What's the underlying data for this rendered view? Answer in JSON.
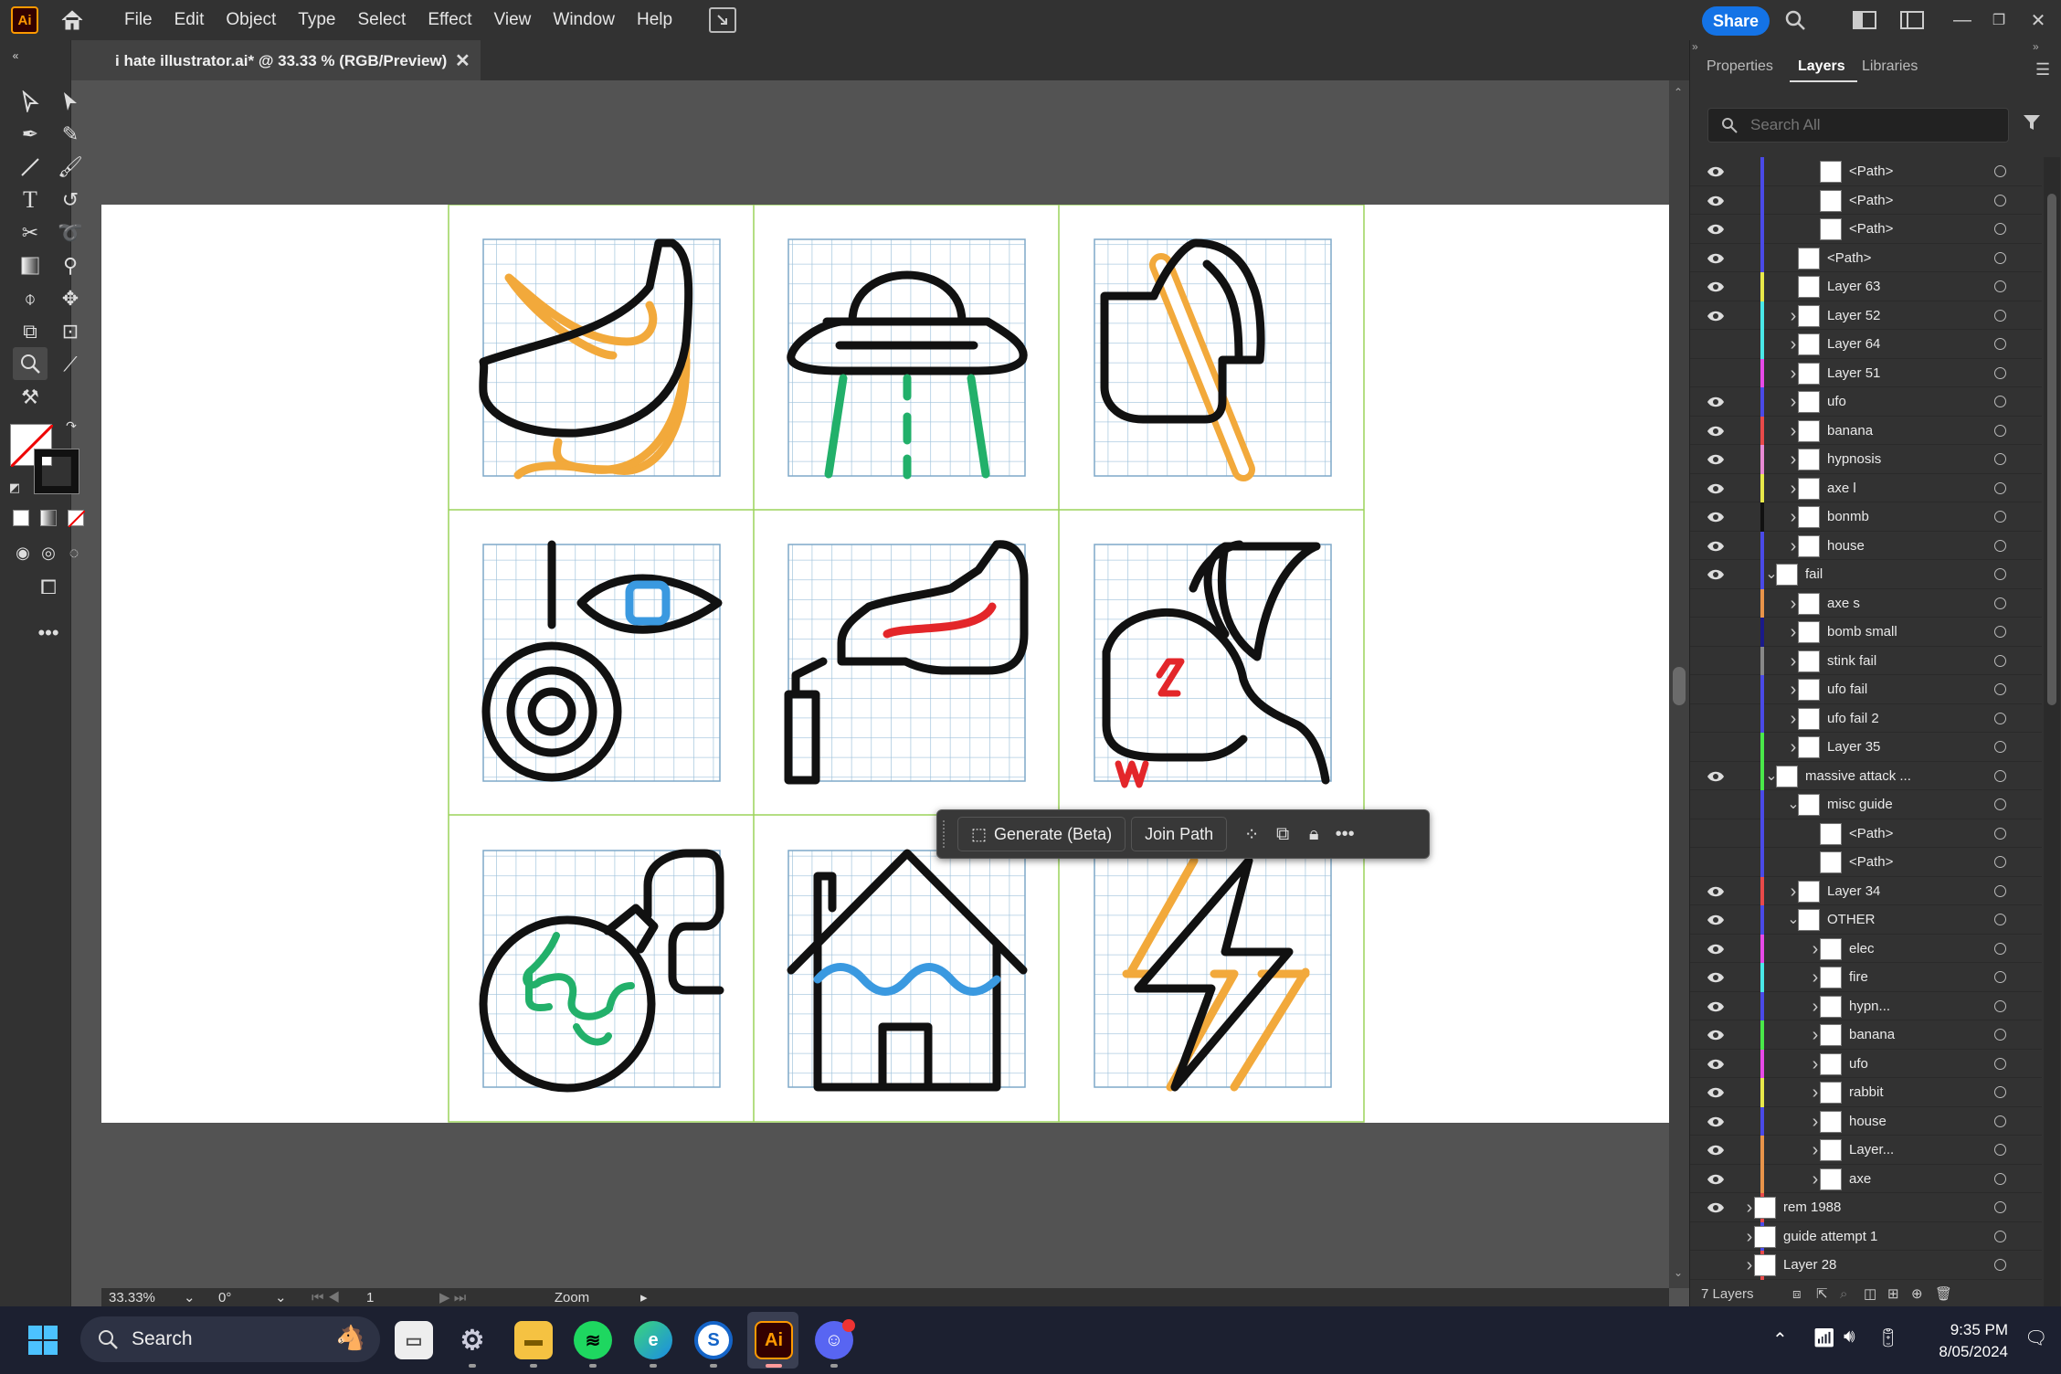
{
  "menubar": {
    "app_logo": "Ai",
    "items": [
      "File",
      "Edit",
      "Object",
      "Type",
      "Select",
      "Effect",
      "View",
      "Window",
      "Help"
    ],
    "share_label": "Share"
  },
  "document": {
    "tab_title": "i hate illustrator.ai* @ 33.33 % (RGB/Preview)",
    "zoom": "33.33%",
    "rotation": "0°",
    "artboard_number": "1",
    "status_label": "Zoom"
  },
  "context_bar": {
    "generate_label": "Generate (Beta)",
    "join_label": "Join Path"
  },
  "panel": {
    "tabs": [
      "Properties",
      "Layers",
      "Libraries"
    ],
    "active_tab": "Layers",
    "search_placeholder": "Search All",
    "footer_count": "7 Layers",
    "rows": [
      {
        "name": "<Path>",
        "visible": true,
        "color": "#4a4ae8",
        "indent": 5,
        "expand": "none"
      },
      {
        "name": "<Path>",
        "visible": true,
        "color": "#4a4ae8",
        "indent": 5,
        "expand": "none"
      },
      {
        "name": "<Path>",
        "visible": true,
        "color": "#4a4ae8",
        "indent": 5,
        "expand": "none"
      },
      {
        "name": "<Path>",
        "visible": true,
        "color": "#4a4ae8",
        "indent": 4,
        "expand": "none"
      },
      {
        "name": "Layer 63",
        "visible": true,
        "color": "#e8e84a",
        "indent": 4,
        "expand": "none"
      },
      {
        "name": "Layer 52",
        "visible": true,
        "color": "#4ae8e8",
        "indent": 4,
        "expand": "right"
      },
      {
        "name": "Layer 64",
        "visible": false,
        "color": "#4ae8e8",
        "indent": 4,
        "expand": "right"
      },
      {
        "name": "Layer 51",
        "visible": false,
        "color": "#e84ae8",
        "indent": 4,
        "expand": "right"
      },
      {
        "name": "ufo",
        "visible": true,
        "color": "#4a4ae8",
        "indent": 4,
        "expand": "right"
      },
      {
        "name": "banana",
        "visible": true,
        "color": "#e84a4a",
        "indent": 4,
        "expand": "right"
      },
      {
        "name": "hypnosis",
        "visible": true,
        "color": "#e88ad4",
        "indent": 4,
        "expand": "right"
      },
      {
        "name": "axe l",
        "visible": true,
        "color": "#e8e84a",
        "indent": 4,
        "expand": "right"
      },
      {
        "name": "bonmb",
        "visible": true,
        "color": "#111111",
        "indent": 4,
        "expand": "right"
      },
      {
        "name": "house",
        "visible": true,
        "color": "#4a4ae8",
        "indent": 4,
        "expand": "right"
      },
      {
        "name": "fail",
        "visible": true,
        "color": "#4a4ae8",
        "indent": 3,
        "expand": "down"
      },
      {
        "name": "axe s",
        "visible": false,
        "color": "#e8944a",
        "indent": 4,
        "expand": "right"
      },
      {
        "name": "bomb small",
        "visible": false,
        "color": "#1a1a8a",
        "indent": 4,
        "expand": "right"
      },
      {
        "name": "stink fail",
        "visible": false,
        "color": "#888888",
        "indent": 4,
        "expand": "right"
      },
      {
        "name": "ufo fail",
        "visible": false,
        "color": "#4a4ae8",
        "indent": 4,
        "expand": "right"
      },
      {
        "name": "ufo fail 2",
        "visible": false,
        "color": "#4a4ae8",
        "indent": 4,
        "expand": "right"
      },
      {
        "name": "Layer 35",
        "visible": false,
        "color": "#4ae84a",
        "indent": 4,
        "expand": "right"
      },
      {
        "name": "massive attack ...",
        "visible": true,
        "color": "#4ae84a",
        "indent": 3,
        "expand": "down"
      },
      {
        "name": "misc guide",
        "visible": false,
        "color": "#4a4ae8",
        "indent": 4,
        "expand": "down"
      },
      {
        "name": "<Path>",
        "visible": false,
        "color": "#4a4ae8",
        "indent": 5,
        "expand": "none"
      },
      {
        "name": "<Path>",
        "visible": false,
        "color": "#4a4ae8",
        "indent": 5,
        "expand": "none"
      },
      {
        "name": "Layer 34",
        "visible": true,
        "color": "#e84a4a",
        "indent": 4,
        "expand": "right"
      },
      {
        "name": "OTHER",
        "visible": true,
        "color": "#4a4ae8",
        "indent": 4,
        "expand": "down"
      },
      {
        "name": "elec",
        "visible": true,
        "color": "#e84ae8",
        "indent": 5,
        "expand": "right"
      },
      {
        "name": "fire",
        "visible": true,
        "color": "#4ae8e8",
        "indent": 5,
        "expand": "right"
      },
      {
        "name": "hypn...",
        "visible": true,
        "color": "#4a4ae8",
        "indent": 5,
        "expand": "right"
      },
      {
        "name": "banana",
        "visible": true,
        "color": "#4ae84a",
        "indent": 5,
        "expand": "right"
      },
      {
        "name": "ufo",
        "visible": true,
        "color": "#e84ae8",
        "indent": 5,
        "expand": "right"
      },
      {
        "name": "rabbit",
        "visible": true,
        "color": "#e8e84a",
        "indent": 5,
        "expand": "right"
      },
      {
        "name": "house",
        "visible": true,
        "color": "#4a4ae8",
        "indent": 5,
        "expand": "right"
      },
      {
        "name": "Layer...",
        "visible": true,
        "color": "#e8944a",
        "indent": 5,
        "expand": "right"
      },
      {
        "name": "axe",
        "visible": true,
        "color": "#e8944a",
        "indent": 5,
        "expand": "right"
      },
      {
        "name": "rem 1988",
        "visible": true,
        "color": "#e84a4a",
        "indent": 2,
        "expand": "right"
      },
      {
        "name": "guide attempt 1",
        "visible": false,
        "color": "#4a4ae8",
        "indent": 2,
        "expand": "right"
      },
      {
        "name": "Layer 28",
        "visible": false,
        "color": "#e84a4a",
        "indent": 2,
        "expand": "right"
      }
    ]
  },
  "taskbar": {
    "search_label": "Search",
    "time": "9:35 PM",
    "date": "8/05/2024"
  }
}
